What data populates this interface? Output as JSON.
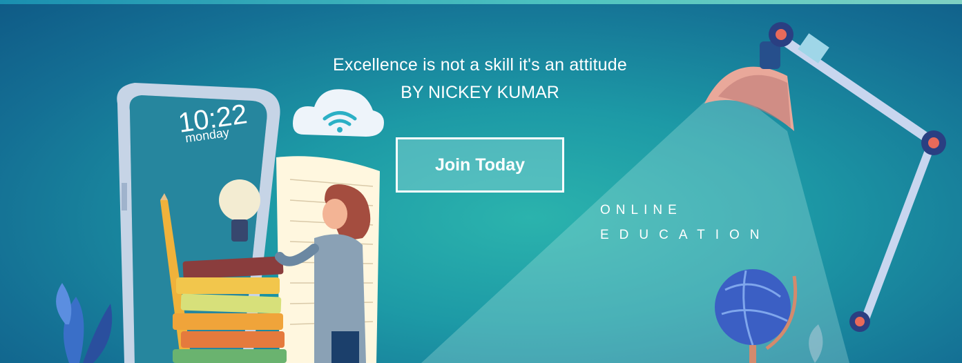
{
  "hero": {
    "quote": "Excellence is not a skill it's an attitude",
    "author": "BY NICKEY KUMAR",
    "cta_label": "Join Today",
    "tagline_line1": "ONLINE",
    "tagline_line2": "EDUCATION"
  },
  "illustration": {
    "phone_time": "10:22",
    "phone_day": "monday",
    "icons": [
      "wifi-cloud-icon",
      "lightbulb-icon",
      "globe-icon",
      "desk-lamp-icon",
      "pencil-icon",
      "books-icon"
    ]
  },
  "colors": {
    "background": "#1d9aa6",
    "button_fill": "#78cdcd",
    "button_border": "#ffffff",
    "text": "#ffffff"
  }
}
